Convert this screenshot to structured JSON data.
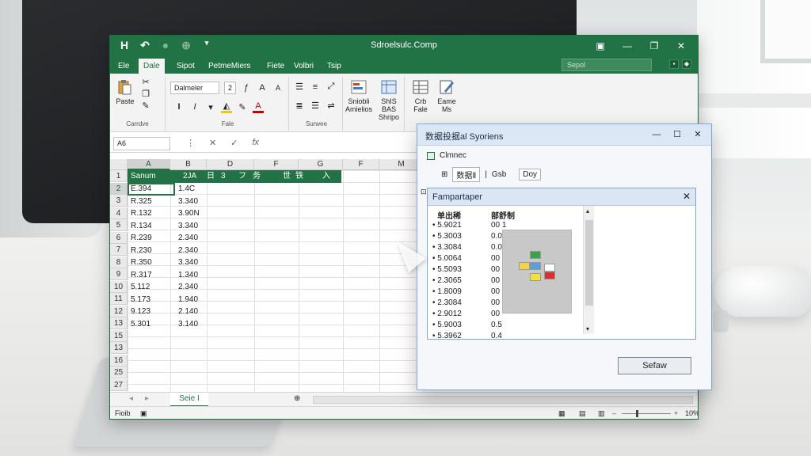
{
  "app": {
    "window_title": "Sdroelsulc.Comp",
    "search_placeholder": "Sepol"
  },
  "quick_access": [
    "H",
    "↶",
    "●",
    "⊕",
    "▾"
  ],
  "tabs": [
    "Ele",
    "Dale",
    "Sipot",
    "PetmeMiers",
    "Fiete",
    "Volbri",
    "Tsip"
  ],
  "ribbon": {
    "clipboard": {
      "paste": "Paste",
      "group": "Carrdve"
    },
    "font": {
      "name": "Dalmeler",
      "size": "2",
      "bold": "I",
      "italic": "I",
      "group": "Fale"
    },
    "alignment": {
      "group": "Surwee"
    },
    "styles": {
      "b1": "Sniobli",
      "b1b": "Amielios",
      "b2": "ShIS BAS",
      "b2b": "Shripo"
    },
    "cells": {
      "b1": "Crb",
      "b1b": "Fale",
      "b2": "Eame",
      "b2b": "Ms"
    }
  },
  "formula_bar": {
    "namebox": "A6",
    "fx": "fx"
  },
  "columns": [
    "A",
    "B",
    "D",
    "F",
    "G",
    "F",
    "M"
  ],
  "rows": [
    "1",
    "2",
    "3",
    "4",
    "5",
    "6",
    "7",
    "8",
    "9",
    "10",
    "11",
    "12",
    "13",
    "15",
    "13",
    "16",
    "25",
    "27"
  ],
  "header_row": [
    "Sanum",
    "2JA",
    "日",
    "3",
    "フ",
    "务",
    "世",
    "铁",
    "入"
  ],
  "col_a": [
    "E.394",
    "R.325",
    "R.132",
    "R.134",
    "R.239",
    "R.230",
    "R.350",
    "R.317",
    "5.112",
    "5.173",
    "9.123",
    "5.301"
  ],
  "col_b": [
    "1.4C",
    "3.340",
    "3.90N",
    "3.340",
    "2.340",
    "2.340",
    "3.340",
    "1.340",
    "2.340",
    "1.940",
    "2.140",
    "3.140"
  ],
  "sheet_tab": "Seie I",
  "status": {
    "left": "Fioib",
    "zoom": "10%"
  },
  "dialog": {
    "title": "数据投据al Syoriens",
    "option": "Clmnec",
    "row2_label": "数据Ⅱ",
    "row2_mid": "Gsb",
    "row2_btn": "Doy",
    "inner_title": "Fampartaper",
    "col1_head": "单出稀",
    "col2_head": "部舒制",
    "values": [
      "5.9021",
      "5.3003",
      "3.3084",
      "5.0064",
      "5.5093",
      "2.3065",
      "1.8009",
      "2.3084",
      "2.9012",
      "5.9003",
      "5.3962"
    ],
    "values2": [
      "00 1",
      "0.0",
      "0.0",
      "00",
      "00",
      "00",
      "00",
      "00",
      "00",
      "0.5",
      "0.4"
    ],
    "ok_button": "Sefaw"
  },
  "colors": {
    "excel_green": "#217346",
    "dialog_border": "#7ea7d8"
  }
}
